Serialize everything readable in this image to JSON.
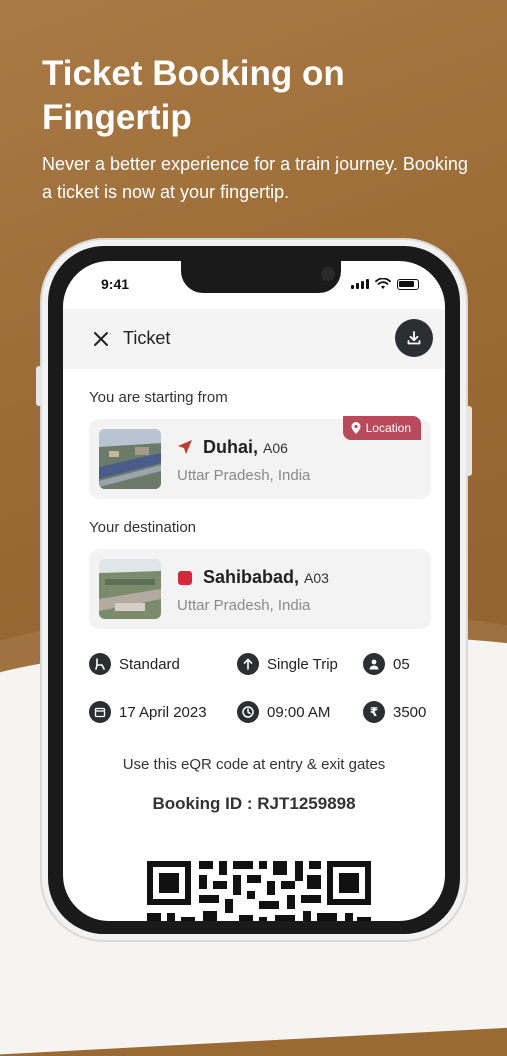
{
  "hero": {
    "title": "Ticket Booking on Fingertip",
    "subtitle": "Never a better experience for a train journey. Booking a ticket is now at your fingertip."
  },
  "status_bar": {
    "time": "9:41"
  },
  "header": {
    "title": "Ticket"
  },
  "origin": {
    "label": "You are starting from",
    "station": "Duhai,",
    "code": "A06",
    "region": "Uttar Pradesh, India",
    "badge": "Location"
  },
  "destination": {
    "label": "Your destination",
    "station": "Sahibabad,",
    "code": "A03",
    "region": "Uttar Pradesh, India"
  },
  "details": {
    "class": "Standard",
    "trip": "Single Trip",
    "passengers": "05",
    "date": "17 April 2023",
    "time": "09:00 AM",
    "fare": "3500"
  },
  "qr_note": "Use this eQR code at entry & exit gates",
  "booking_id": "Booking ID : RJT1259898",
  "colors": {
    "brand_brown": "#9a6a34",
    "badge_red": "#b84a5c",
    "origin_arrow": "#c0392b",
    "destination_marker": "#d62839",
    "dark_icon": "#2b2f33"
  }
}
